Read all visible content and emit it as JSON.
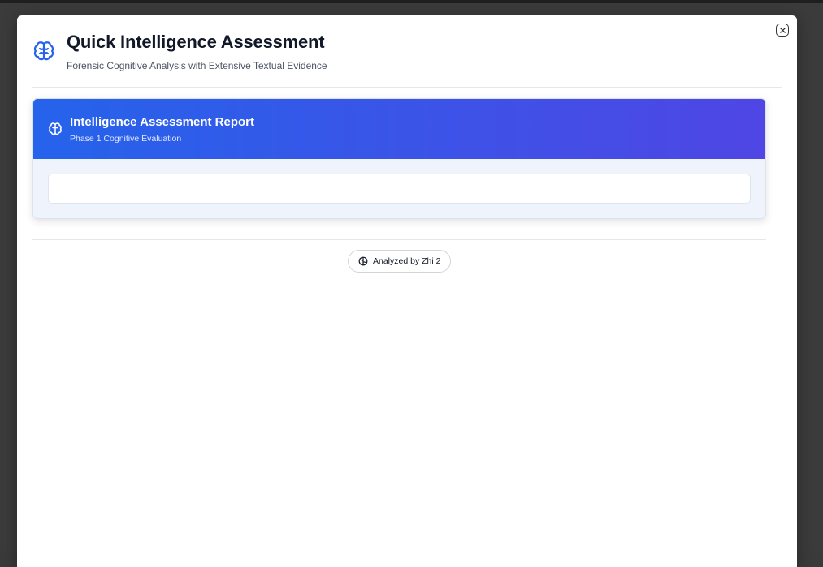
{
  "modal": {
    "title": "Quick Intelligence Assessment",
    "subtitle": "Forensic Cognitive Analysis with Extensive Textual Evidence",
    "close_icon": "close-icon",
    "header_icon": "brain-icon"
  },
  "report": {
    "title": "Intelligence Assessment Report",
    "subtitle": "Phase 1 Cognitive Evaluation",
    "icon": "brain-icon",
    "content": ""
  },
  "footer": {
    "badge_label": "Analyzed by Zhi 2",
    "badge_icon": "brain-icon"
  },
  "colors": {
    "accent_start": "#2563eb",
    "accent_end": "#4f46e5",
    "icon_blue": "#2563eb"
  }
}
